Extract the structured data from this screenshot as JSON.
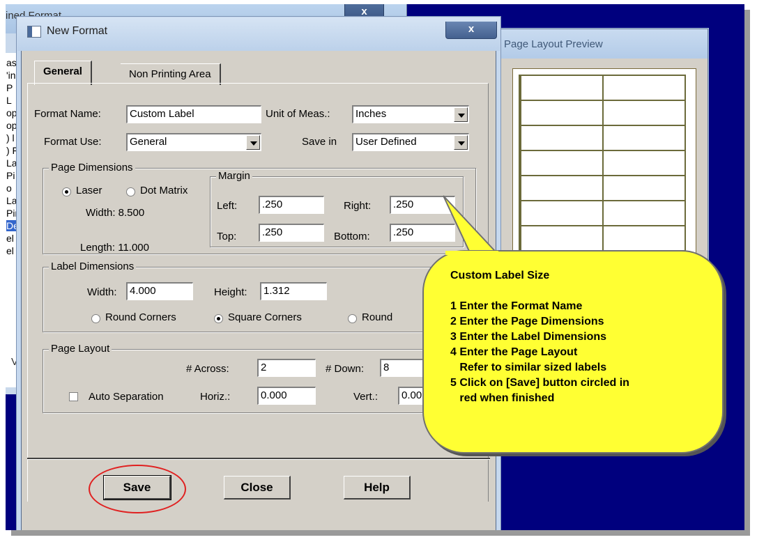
{
  "background_window": {
    "title": "ined Format",
    "close_label": "x",
    "list_fragments": [
      "as",
      "'in",
      "P",
      "L",
      "op",
      "op",
      ") l",
      ") F",
      "La",
      "Pi",
      "o",
      "La",
      "Pir",
      "De",
      "el",
      "el"
    ],
    "bottom_fragment": "V"
  },
  "preview": {
    "title": "Page Layout Preview"
  },
  "dialog": {
    "title": "New Format",
    "close_label": "x",
    "tabs": {
      "general": "General",
      "non_printing": "Non Printing Area"
    },
    "format_name_label": "Format Name:",
    "format_name_value": "Custom Label",
    "unit_label": "Unit of Meas.:",
    "unit_value": "Inches",
    "format_use_label": "Format Use:",
    "format_use_value": "General",
    "save_in_label": "Save in",
    "save_in_value": "User Defined",
    "page_dimensions": {
      "title": "Page Dimensions",
      "laser": "Laser",
      "dot_matrix": "Dot Matrix",
      "width_text": "Width:  8.500",
      "length_text": "Length:  11.000"
    },
    "margin": {
      "title": "Margin",
      "left_label": "Left:",
      "left_value": ".250",
      "right_label": "Right:",
      "right_value": ".250",
      "top_label": "Top:",
      "top_value": ".250",
      "bottom_label": "Bottom:",
      "bottom_value": ".250"
    },
    "label_dimensions": {
      "title": "Label Dimensions",
      "width_label": "Width:",
      "width_value": "4.000",
      "height_label": "Height:",
      "height_value": "1.312",
      "round_corners": "Round Corners",
      "square_corners": "Square Corners",
      "round": "Round"
    },
    "page_layout": {
      "title": "Page Layout",
      "across_label": "# Across:",
      "across_value": "2",
      "down_label": "# Down:",
      "down_value": "8",
      "auto_sep": "Auto Separation",
      "horiz_label": "Horiz.:",
      "horiz_value": "0.000",
      "vert_label": "Vert.:",
      "vert_value": "0.00"
    },
    "buttons": {
      "save": "Save",
      "close": "Close",
      "help": "Help"
    }
  },
  "callout": {
    "title": "Custom Label Size",
    "lines": [
      "1 Enter the Format Name",
      "2 Enter the Page Dimensions",
      "3 Enter the Label Dimensions",
      "4 Enter the Page Layout",
      "   Refer to similar sized labels",
      "5 Click on [Save] button circled in",
      "   red when finished"
    ],
    "color": "#ffff33"
  },
  "colors": {
    "desktop": "#00007e",
    "highlight_circle": "#e02020"
  }
}
